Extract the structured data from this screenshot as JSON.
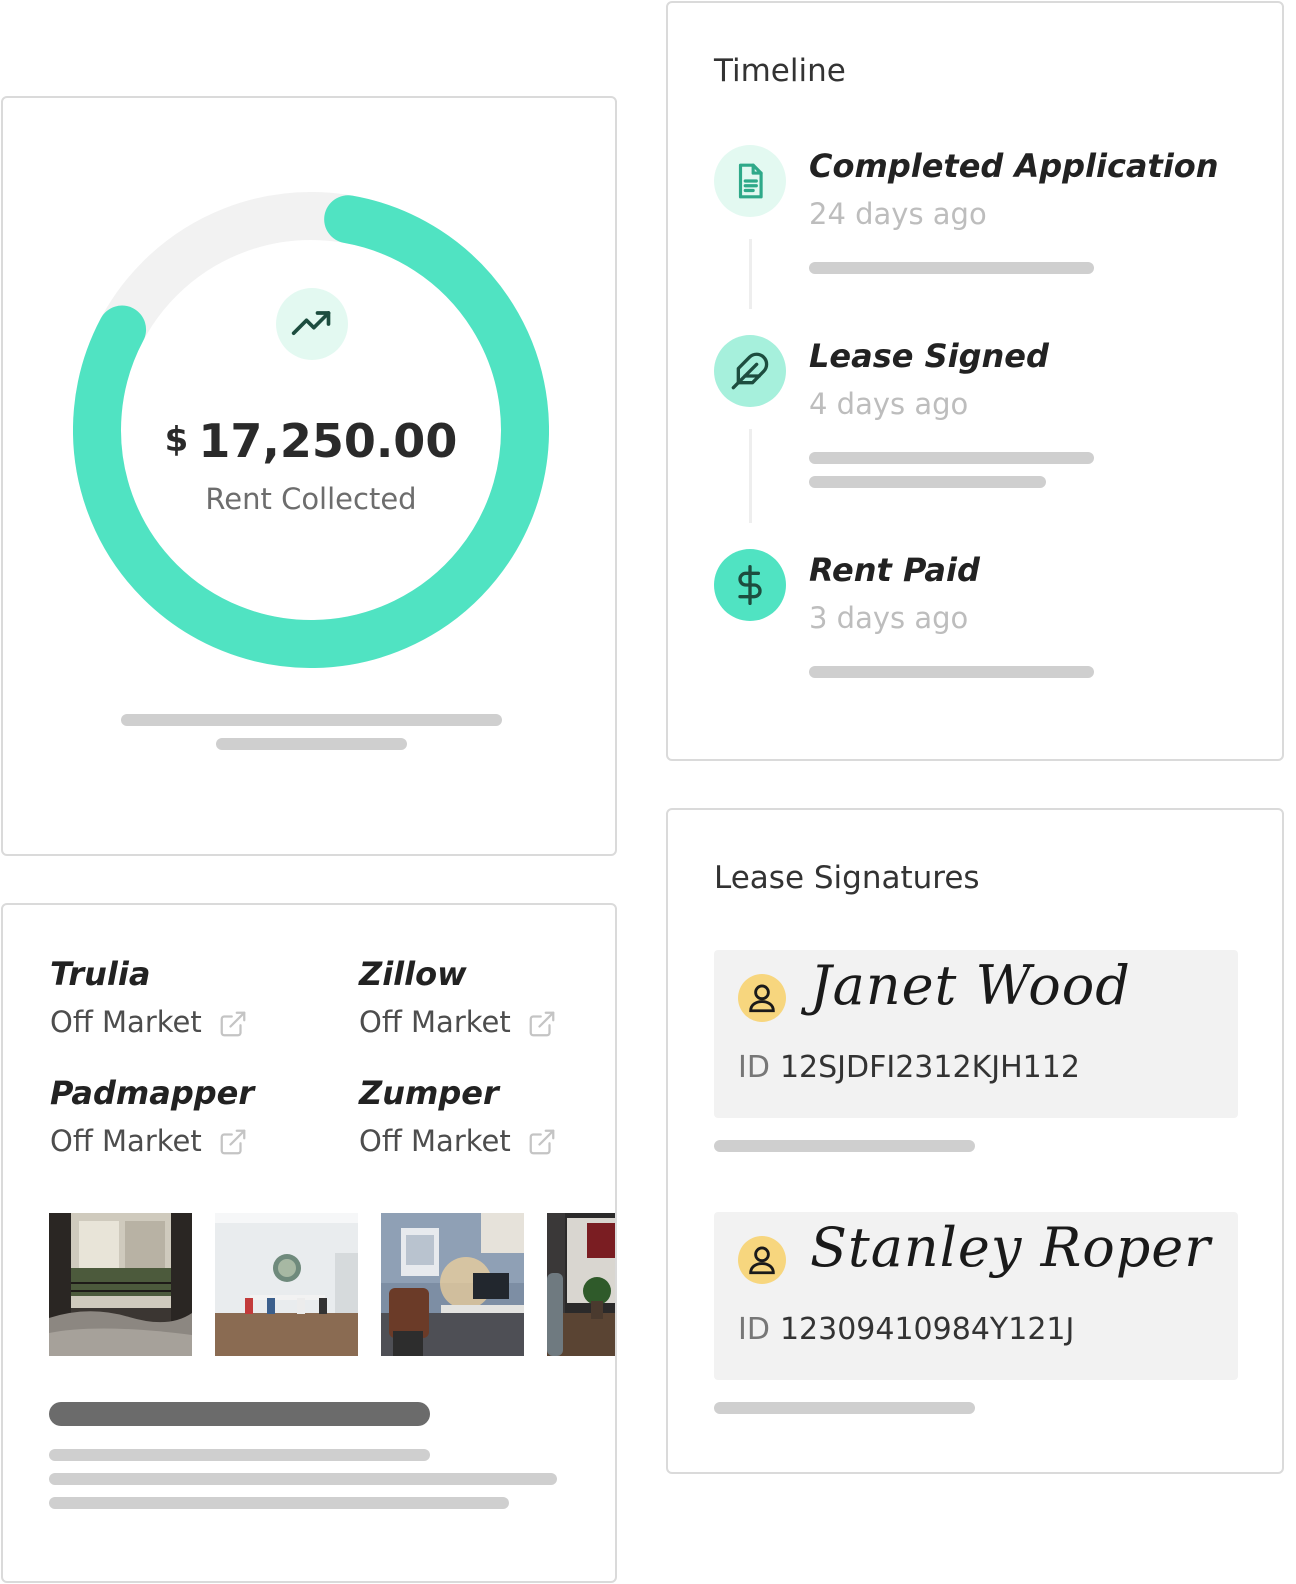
{
  "rent": {
    "currency": "$",
    "amount": "17,250.00",
    "label": "Rent Collected",
    "progress_fraction": 0.8,
    "icon": "trending-up-icon",
    "colors": {
      "ring": "#50e3c2",
      "track": "#f2f2f2",
      "badge": "#e3f9f1"
    }
  },
  "timeline": {
    "title": "Timeline",
    "events": [
      {
        "title": "Completed Application",
        "time": "24 days ago",
        "icon": "document-icon"
      },
      {
        "title": "Lease Signed",
        "time": "4 days ago",
        "icon": "feather-icon"
      },
      {
        "title": "Rent Paid",
        "time": "3 days ago",
        "icon": "dollar-icon"
      }
    ]
  },
  "listings": {
    "sites": [
      {
        "name": "Trulia",
        "status": "Off Market",
        "icon": "external-link-icon"
      },
      {
        "name": "Zillow",
        "status": "Off Market",
        "icon": "external-link-icon"
      },
      {
        "name": "Padmapper",
        "status": "Off Market",
        "icon": "external-link-icon"
      },
      {
        "name": "Zumper",
        "status": "Off Market",
        "icon": "external-link-icon"
      }
    ],
    "photos": [
      "bedroom-window-photo",
      "dining-room-photo",
      "home-office-photo",
      "living-room-photo"
    ]
  },
  "signatures": {
    "title": "Lease Signatures",
    "id_prefix": "ID",
    "people": [
      {
        "name": "Janet Wood",
        "id": "12SJDFI2312KJH112",
        "icon": "person-icon"
      },
      {
        "name": "Stanley Roper",
        "id": "12309410984Y121J",
        "icon": "person-icon"
      }
    ]
  }
}
